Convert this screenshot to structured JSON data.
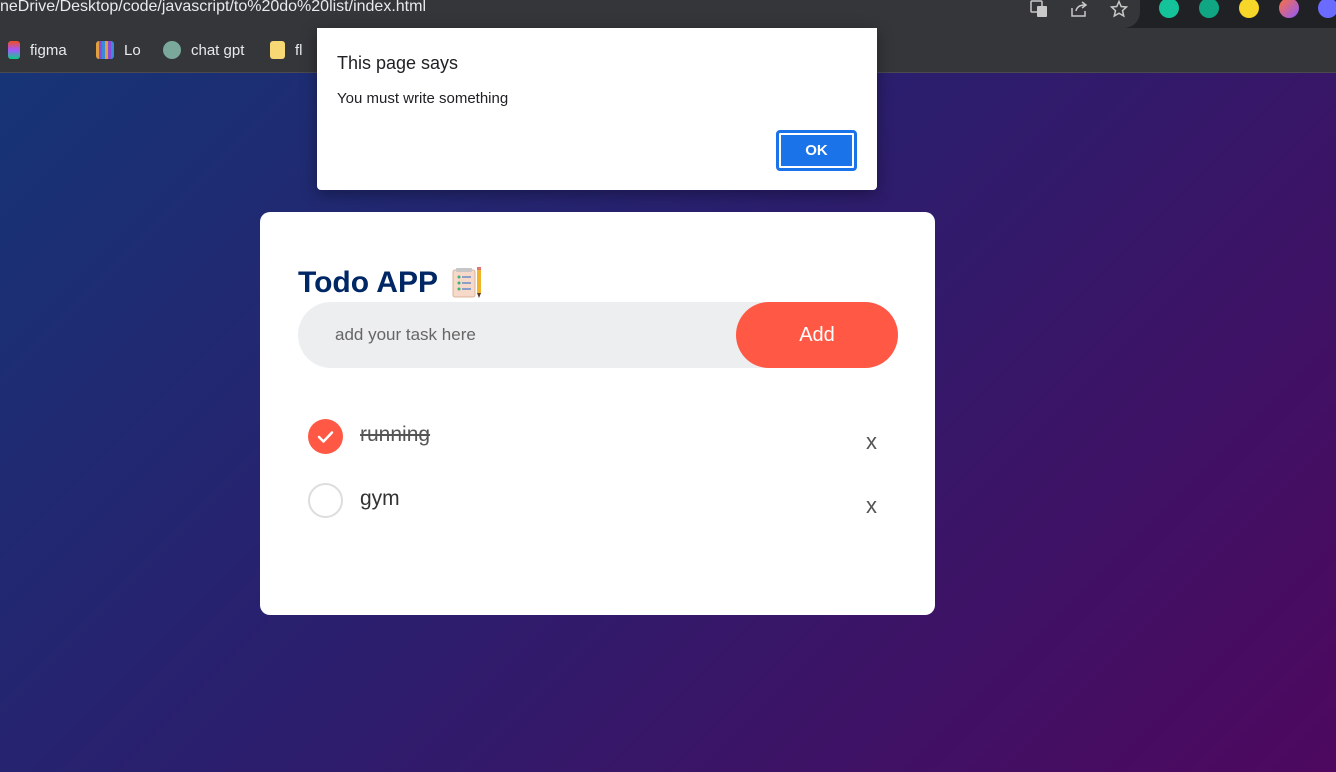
{
  "browser": {
    "url": "neDrive/Desktop/code/javascript/to%20do%20list/index.html",
    "toolbar_icons": [
      "translate-icon",
      "share-icon",
      "star-icon"
    ],
    "extensions": [
      "sync-extension-icon",
      "grammarly-icon",
      "lightbulb-extension-icon",
      "firefox-relay-icon",
      "settings-extension-icon"
    ],
    "bookmarks": [
      {
        "label": "figma",
        "icon": "figma-icon"
      },
      {
        "label": "Lo",
        "icon": "library-icon"
      },
      {
        "label": "chat gpt",
        "icon": "chatgpt-icon"
      },
      {
        "label": "fl",
        "icon": "folder-icon"
      }
    ]
  },
  "alert": {
    "title": "This page says",
    "message": "You must write something",
    "ok_label": "OK"
  },
  "app": {
    "title": "Todo APP",
    "title_icon": "notepad-icon",
    "input_placeholder": "add your task here",
    "add_label": "Add",
    "tasks": [
      {
        "text": "running",
        "done": true
      },
      {
        "text": "gym",
        "done": false
      }
    ],
    "delete_label": "x",
    "colors": {
      "accent": "#ff5945",
      "title": "#002765",
      "dialog_button": "#1a73e8"
    }
  }
}
